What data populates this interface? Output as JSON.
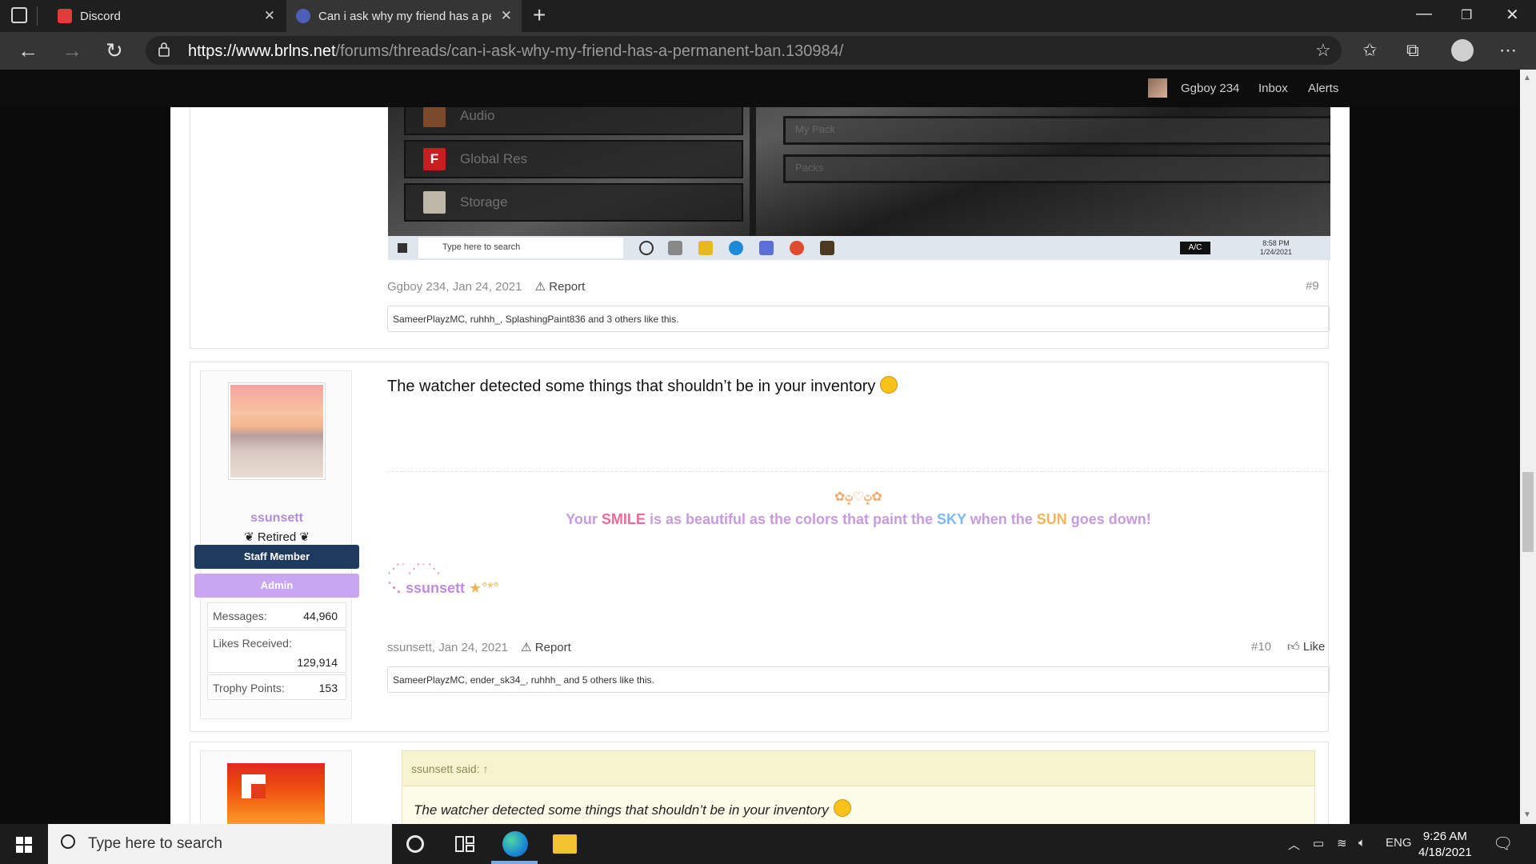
{
  "browser": {
    "tabs": [
      {
        "title": "Discord"
      },
      {
        "title": "Can i ask why my friend has a permanent ban"
      }
    ],
    "url_host": "https://www.brlns.net",
    "url_path": "/forums/threads/can-i-ask-why-my-friend-has-a-permanent-ban.130984/"
  },
  "site_nav": {
    "username": "Ggboy 234",
    "inbox": "Inbox",
    "alerts": "Alerts"
  },
  "embedded_screenshot": {
    "menu": [
      "Audio",
      "Global Res",
      "Storage"
    ],
    "slots": [
      "My Pack",
      "Packs"
    ],
    "taskbar_search": "Type here to search",
    "ac_label": "A/C",
    "time": "8:58 PM",
    "date": "1/24/2021"
  },
  "posts": [
    {
      "author": "Ggboy 234",
      "date": "Jan 24, 2021",
      "report": "Report",
      "number": "#9",
      "likes": "SameerPlayzMC, ruhhh_, SplashingPaint836 and 3 others like this."
    },
    {
      "author": "ssunsett",
      "title": "❦ Retired ❦",
      "badges": [
        "Staff Member",
        "Admin"
      ],
      "stats": {
        "messages_label": "Messages:",
        "messages": "44,960",
        "likes_label": "Likes Received:",
        "likes_received": "129,914",
        "trophy_label": "Trophy Points:",
        "trophy": "153"
      },
      "message": "The watcher detected some things that shouldn’t be in your inventory",
      "signature": {
        "deco": "✿ݓ♡ݓ✿",
        "line_parts": [
          "Your ",
          "SMILE",
          " is as beautiful as the colors that paint the ",
          "SKY",
          " when the ",
          "SUN",
          " goes down!"
        ],
        "dots": "⋰˙⋰˙⋱",
        "name_prefix": "˙·.",
        "name": "ssunsett",
        "stars": "★°*°"
      },
      "date": "Jan 24, 2021",
      "report": "Report",
      "number": "#10",
      "like": "Like",
      "likes": "SameerPlayzMC, ender_sk34_, ruhhh_ and 5 others like this."
    },
    {
      "quote_author": "ssunsett said: ↑",
      "quote_text": "The watcher detected some things that shouldn’t be in your inventory"
    }
  ],
  "taskbar": {
    "search": "Type here to search",
    "lang": "ENG",
    "time": "9:26 AM",
    "date": "4/18/2021"
  }
}
